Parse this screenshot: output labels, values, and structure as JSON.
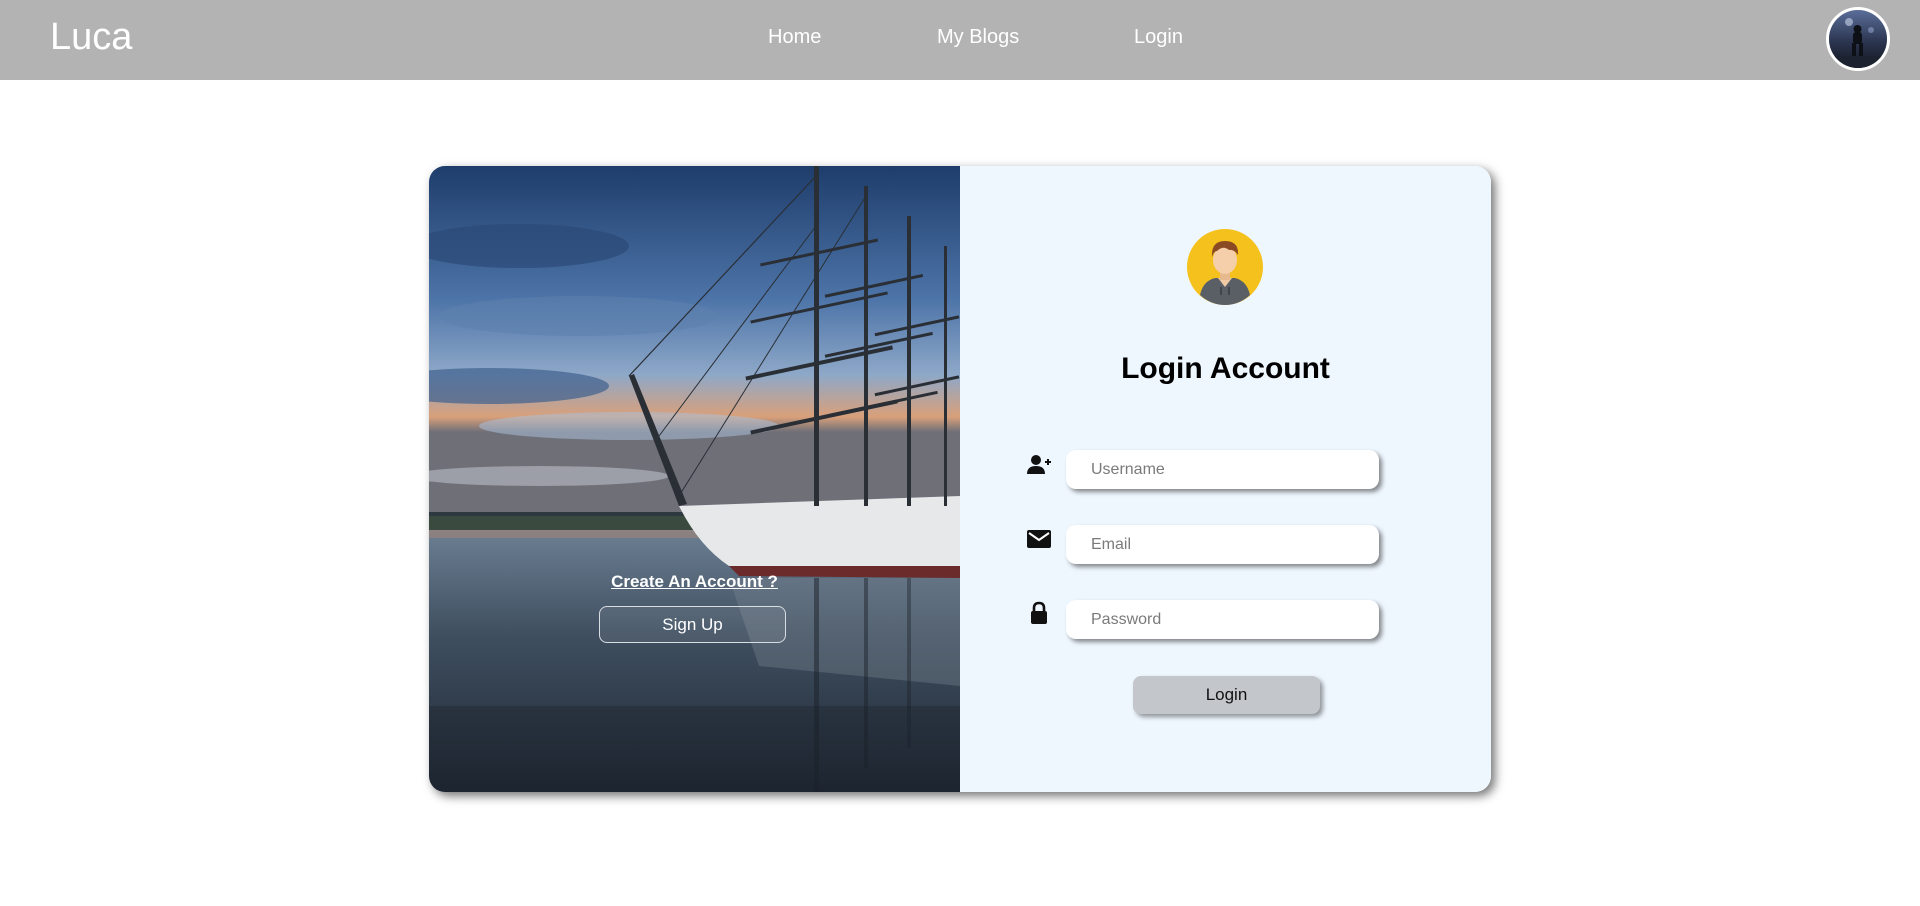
{
  "navbar": {
    "brand": "Luca",
    "links": [
      {
        "label": "Home"
      },
      {
        "label": "My Blogs"
      },
      {
        "label": "Login"
      }
    ],
    "background": "#b3b3b3"
  },
  "hero": {
    "create_account_text": "Create An Account ?",
    "signup_label": "Sign Up"
  },
  "login_form": {
    "title": "Login Account",
    "username": {
      "placeholder": "Username",
      "value": "",
      "icon": "user-plus-icon"
    },
    "email": {
      "placeholder": "Email",
      "value": "",
      "icon": "envelope-icon"
    },
    "password": {
      "placeholder": "Password",
      "value": "",
      "icon": "lock-icon"
    },
    "submit_label": "Login",
    "panel_background": "#eef6fe"
  }
}
